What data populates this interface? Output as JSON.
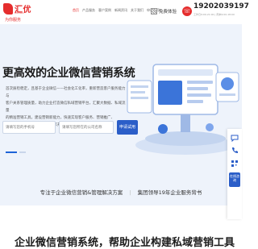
{
  "brand": {
    "name": "汇优",
    "sub": "HUIYOU",
    "slogan": "为你服务"
  },
  "nav": {
    "items": [
      {
        "label": "首页",
        "active": true
      },
      {
        "label": "产品服务"
      },
      {
        "label": "客户案例"
      },
      {
        "label": "新闻资讯"
      },
      {
        "label": "关于我们"
      },
      {
        "label": "申请试用"
      }
    ]
  },
  "header": {
    "free_demo": "免费体验",
    "phone_number": "19202039197",
    "phone_sub": "工作日9:00-21:00 | 周末9:00-18:00"
  },
  "hero": {
    "title": "更高效的企业微信营销系统",
    "desc": [
      "首次质检稳定，且基于企业微信——社会化工化率，重新营造客户服务能力与",
      "客户关系管理质量，助力企业打造微信私域营销平台，汇聚大数据、私域流量",
      "的精准营销工具，建设营销新能力，快速实现客户服务、营销推广、",
      "电商销售等智能化管理一站式解决方案"
    ],
    "phone_placeholder": "请填写您的手机号",
    "company_placeholder": "请填写您所在的公司名称",
    "submit_label": "申请试用"
  },
  "taglines": {
    "left": "专注于企业微信营销&管理解决方案",
    "right": "集团领导19年企业服务背书"
  },
  "section": {
    "title": "企业微信营销系统，帮助企业构建私域营销工具"
  },
  "side": {
    "consult": "在线咨询"
  },
  "colors": {
    "brand_red": "#e52d2d",
    "accent_blue": "#2b5ec8",
    "hero_bg": "#eef3fb"
  }
}
